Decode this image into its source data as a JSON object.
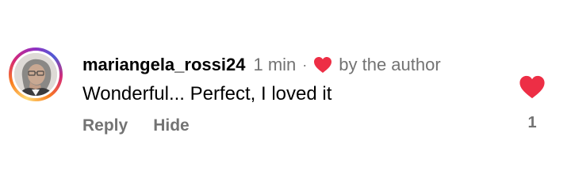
{
  "comment": {
    "username": "mariangela_rossi24",
    "time": "1 min",
    "separator": "·",
    "author_like_label": "by the author",
    "text": "Wonderful... Perfect, I loved it",
    "actions": {
      "reply_label": "Reply",
      "hide_label": "Hide"
    },
    "likes": {
      "count": "1"
    }
  },
  "colors": {
    "heart": "#ed2e45",
    "secondary_text": "#737373",
    "primary_text": "#000000"
  },
  "icons": {
    "author_like": "heart-icon",
    "like": "heart-icon"
  }
}
